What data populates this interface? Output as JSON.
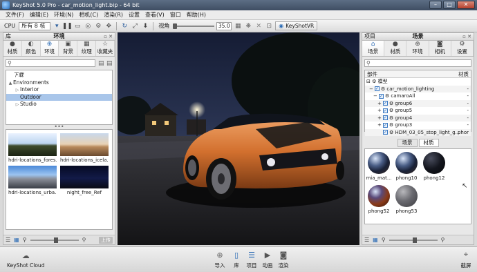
{
  "window": {
    "title": "KeyShot 5.0 Pro  -  car_motion_light.bip  -  64 bit",
    "buttons": [
      "–",
      "□",
      "✕"
    ]
  },
  "menu": [
    "文件(F)",
    "编辑(E)",
    "环境(N)",
    "相机(C)",
    "渲染(R)",
    "设置",
    "查看(V)",
    "窗口",
    "帮助(H)"
  ],
  "toolbar": {
    "cpu_label": "CPU",
    "cpu_value": "所有 8 核",
    "fov_label": "视角",
    "fov_value": "35.0",
    "keyshotvr_label": "KeyShotVR"
  },
  "library": {
    "title_left": "库",
    "title_center": "环境",
    "tabs": [
      {
        "label": "材质",
        "icon": "ball-icon"
      },
      {
        "label": "颜色",
        "icon": "palette-icon"
      },
      {
        "label": "环境",
        "icon": "globe-icon"
      },
      {
        "label": "背景",
        "icon": "image-icon"
      },
      {
        "label": "纹理",
        "icon": "texture-icon"
      },
      {
        "label": "收藏夹",
        "icon": "star-icon"
      }
    ],
    "active_tab": 2,
    "search_placeholder": "",
    "tree": [
      {
        "label": "下载",
        "indent": 0,
        "arrow": "",
        "italic": true
      },
      {
        "label": "Environments",
        "indent": 0,
        "arrow": "▲"
      },
      {
        "label": "Interior",
        "indent": 1,
        "arrow": "▷"
      },
      {
        "label": "Outdoor",
        "indent": 1,
        "arrow": "",
        "selected": true
      },
      {
        "label": "Studio",
        "indent": 1,
        "arrow": "▷"
      }
    ],
    "thumbnails": [
      {
        "caption": "hdri-locations_fores...",
        "style": "forest"
      },
      {
        "caption": "hdri-locations_icela...",
        "style": "iceland"
      },
      {
        "caption": "hdri-locations_urba...",
        "style": "urban"
      },
      {
        "caption": "night_free_Ref",
        "style": "night"
      }
    ],
    "upload_label": "上传"
  },
  "project": {
    "title_left": "项目",
    "title_center": "场景",
    "tabs": [
      {
        "label": "场景",
        "icon": "scene-icon"
      },
      {
        "label": "材质",
        "icon": "ball-icon"
      },
      {
        "label": "环境",
        "icon": "globe-icon"
      },
      {
        "label": "相机",
        "icon": "camera-icon"
      },
      {
        "label": "设置",
        "icon": "gear-icon"
      }
    ],
    "active_tab": 0,
    "tree_header": "部件",
    "tree_header_material": "材质",
    "tree": [
      {
        "label": "模型",
        "indent": 0,
        "prefix": "⊟",
        "check": false,
        "mat": ""
      },
      {
        "label": "car_motion_lighting",
        "indent": 1,
        "prefix": "−",
        "check": true,
        "mat": "-"
      },
      {
        "label": "camaroAll",
        "indent": 2,
        "prefix": "−",
        "check": true,
        "mat": "-"
      },
      {
        "label": "group6",
        "indent": 3,
        "prefix": "+",
        "check": true,
        "mat": "-"
      },
      {
        "label": "group5",
        "indent": 3,
        "prefix": "+",
        "check": true,
        "mat": "-"
      },
      {
        "label": "group4",
        "indent": 3,
        "prefix": "+",
        "check": true,
        "mat": "-"
      },
      {
        "label": "group3",
        "indent": 3,
        "prefix": "+",
        "check": true,
        "mat": "-"
      },
      {
        "label": "HDM_03_05_stop_light_g...",
        "indent": 3,
        "prefix": "",
        "check": true,
        "mat": "phor"
      }
    ],
    "subtabs": [
      "场景",
      "材质"
    ],
    "active_subtab": 1,
    "materials": [
      {
        "caption": "mia_mat...",
        "style": "env"
      },
      {
        "caption": "phong10",
        "style": "env"
      },
      {
        "caption": "phong12",
        "style": "dark"
      },
      {
        "caption": "phong52",
        "style": "orange"
      },
      {
        "caption": "phong53",
        "style": "grey"
      }
    ]
  },
  "bottom": {
    "cloud_label": "KeyShot Cloud",
    "items": [
      "导入",
      "库",
      "项目",
      "动画",
      "渲染"
    ],
    "screenshot_label": "截屏"
  }
}
